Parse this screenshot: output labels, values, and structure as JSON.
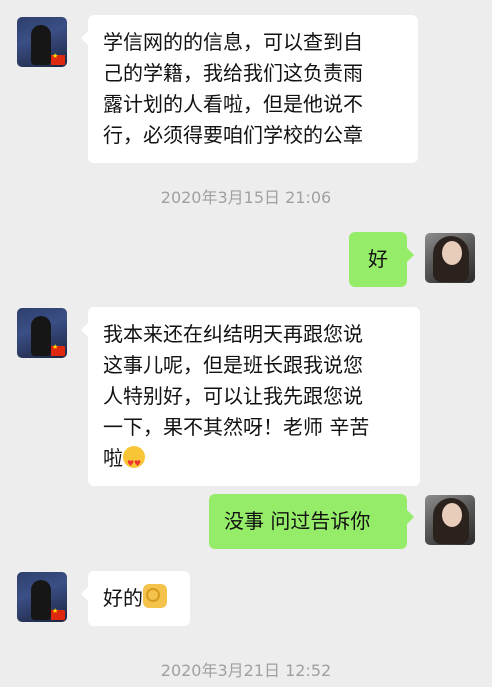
{
  "messages": [
    {
      "side": "left",
      "lines": [
        "学信网的的信息，可以查到自",
        "己的学籍，我给我们这负责雨",
        "露计划的人看啦，但是他说不",
        "行，必须得要咱们学校的公章"
      ]
    },
    {
      "timestamp": "2020年3月15日 21:06"
    },
    {
      "side": "right",
      "text": "好"
    },
    {
      "side": "left",
      "lines": [
        "我本来还在纠结明天再跟您说",
        "这事儿呢，但是班长跟我说您",
        "人特别好，可以让我先跟您说",
        "一下，果不其然呀！老师 辛苦",
        "啦"
      ],
      "emoji": "heart-eyes-emoji"
    },
    {
      "side": "right",
      "text": "没事 问过告诉你"
    },
    {
      "side": "left",
      "text": "好的",
      "emoji": "ok-hand-emoji"
    },
    {
      "timestamp": "2020年3月21日 12:52"
    }
  ]
}
